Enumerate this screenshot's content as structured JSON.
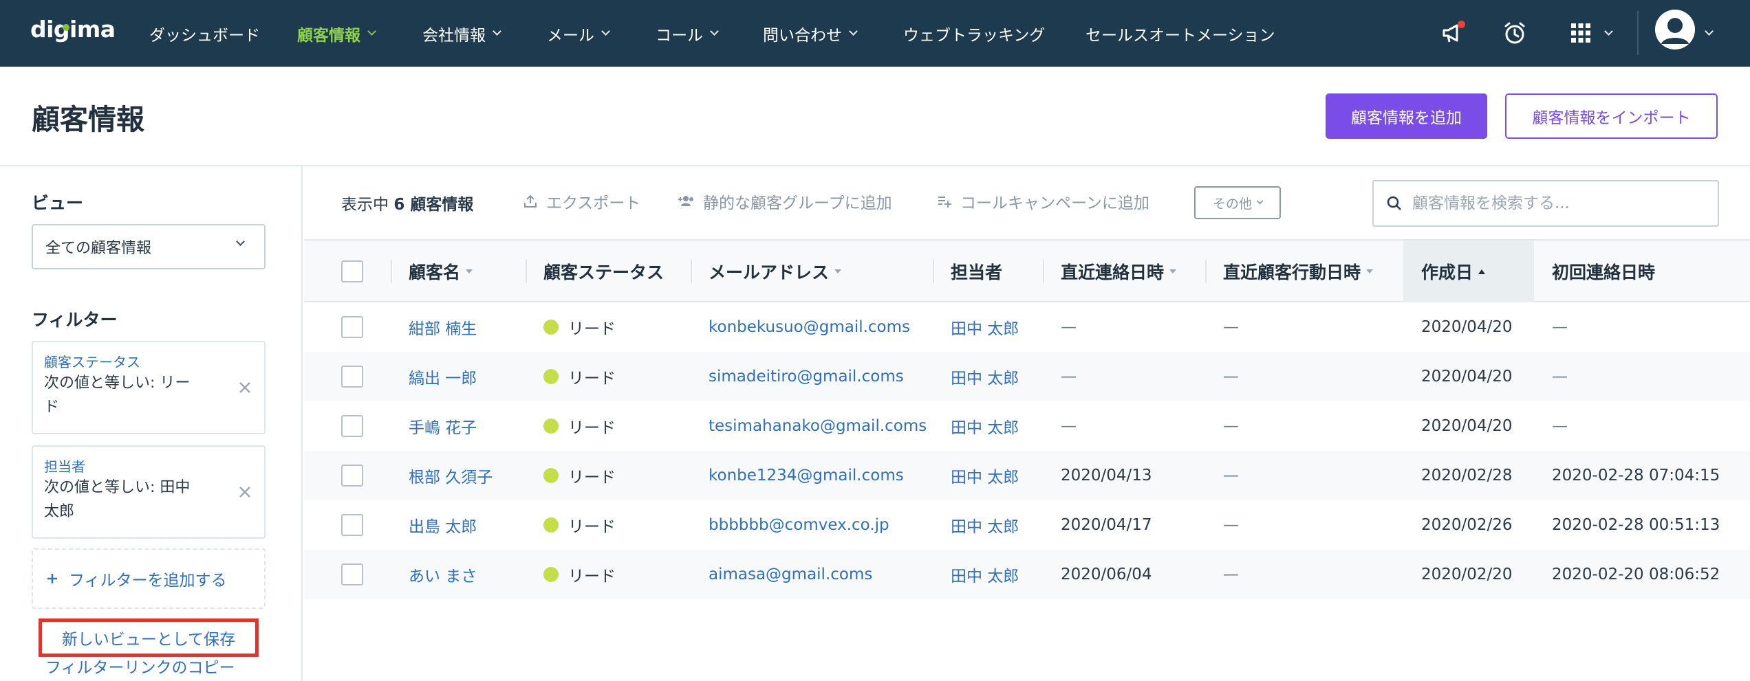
{
  "app": {
    "logo": "digima"
  },
  "nav": {
    "items": [
      {
        "label": "ダッシュボード",
        "chevron": false,
        "active": false
      },
      {
        "label": "顧客情報",
        "chevron": true,
        "active": true
      },
      {
        "label": "会社情報",
        "chevron": true,
        "active": false
      },
      {
        "label": "メール",
        "chevron": true,
        "active": false
      },
      {
        "label": "コール",
        "chevron": true,
        "active": false
      },
      {
        "label": "問い合わせ",
        "chevron": true,
        "active": false
      },
      {
        "label": "ウェブトラッキング",
        "chevron": false,
        "active": false
      },
      {
        "label": "セールスオートメーション",
        "chevron": false,
        "active": false
      }
    ],
    "icons": [
      "megaphone-icon",
      "alarm-clock-icon",
      "apps-grid-icon",
      "user-avatar-icon"
    ]
  },
  "page": {
    "title": "顧客情報",
    "add_button": "顧客情報を追加",
    "import_button": "顧客情報をインポート"
  },
  "sidebar": {
    "view_heading": "ビュー",
    "view_selected": "全ての顧客情報",
    "filter_heading": "フィルター",
    "filters": [
      {
        "label": "顧客ステータス",
        "value_line1": "次の値と等しい: リー",
        "value_line2": "ド"
      },
      {
        "label": "担当者",
        "value_line1": "次の値と等しい: 田中",
        "value_line2": "太郎"
      }
    ],
    "add_filter": "フィルターを追加する",
    "save_view": "新しいビューとして保存",
    "filter_link_copy": "フィルターリンクのコピー"
  },
  "toolbar": {
    "showing_prefix": "表示中",
    "showing_count": "6 顧客情報",
    "export": "エクスポート",
    "add_static_group": "静的な顧客グループに追加",
    "add_call_campaign": "コールキャンペーンに追加",
    "more": "その他",
    "search_placeholder": "顧客情報を検索する..."
  },
  "table": {
    "columns": [
      "顧客名",
      "顧客ステータス",
      "メールアドレス",
      "担当者",
      "直近連絡日時",
      "直近顧客行動日時",
      "作成日",
      "初回連絡日時"
    ],
    "sorted_column": "作成日",
    "sort_direction": "ascending",
    "rows": [
      {
        "name": "紺部 楠生",
        "status": "リード",
        "email": "konbekusuo@gmail.coms",
        "owner": "田中 太郎",
        "last_contact": "—",
        "last_action": "—",
        "created": "2020/04/20",
        "first_contact": "—"
      },
      {
        "name": "縞出 一郎",
        "status": "リード",
        "email": "simadeitiro@gmail.coms",
        "owner": "田中 太郎",
        "last_contact": "—",
        "last_action": "—",
        "created": "2020/04/20",
        "first_contact": "—"
      },
      {
        "name": "手嶋 花子",
        "status": "リード",
        "email": "tesimahanako@gmail.coms",
        "owner": "田中 太郎",
        "last_contact": "—",
        "last_action": "—",
        "created": "2020/04/20",
        "first_contact": "—"
      },
      {
        "name": "根部 久須子",
        "status": "リード",
        "email": "konbe1234@gmail.coms",
        "owner": "田中 太郎",
        "last_contact": "2020/04/13",
        "last_action": "—",
        "created": "2020/02/28",
        "first_contact": "2020-02-28 07:04:15"
      },
      {
        "name": "出島 太郎",
        "status": "リード",
        "email": "bbbbbb@comvex.co.jp",
        "owner": "田中 太郎",
        "last_contact": "2020/04/17",
        "last_action": "—",
        "created": "2020/02/26",
        "first_contact": "2020-02-28 00:51:13"
      },
      {
        "name": "あい まさ",
        "status": "リード",
        "email": "aimasa@gmail.coms",
        "owner": "田中 太郎",
        "last_contact": "2020/06/04",
        "last_action": "—",
        "created": "2020/02/20",
        "first_contact": "2020-02-20 08:06:52"
      }
    ]
  },
  "colors": {
    "nav_bg": "#1d3a4e",
    "nav_active": "#8fd14f",
    "accent_purple": "#7a4de8",
    "link_blue": "#2f6fbf",
    "status_lead": "#c6dd4a",
    "highlight_red": "#e8312a"
  }
}
